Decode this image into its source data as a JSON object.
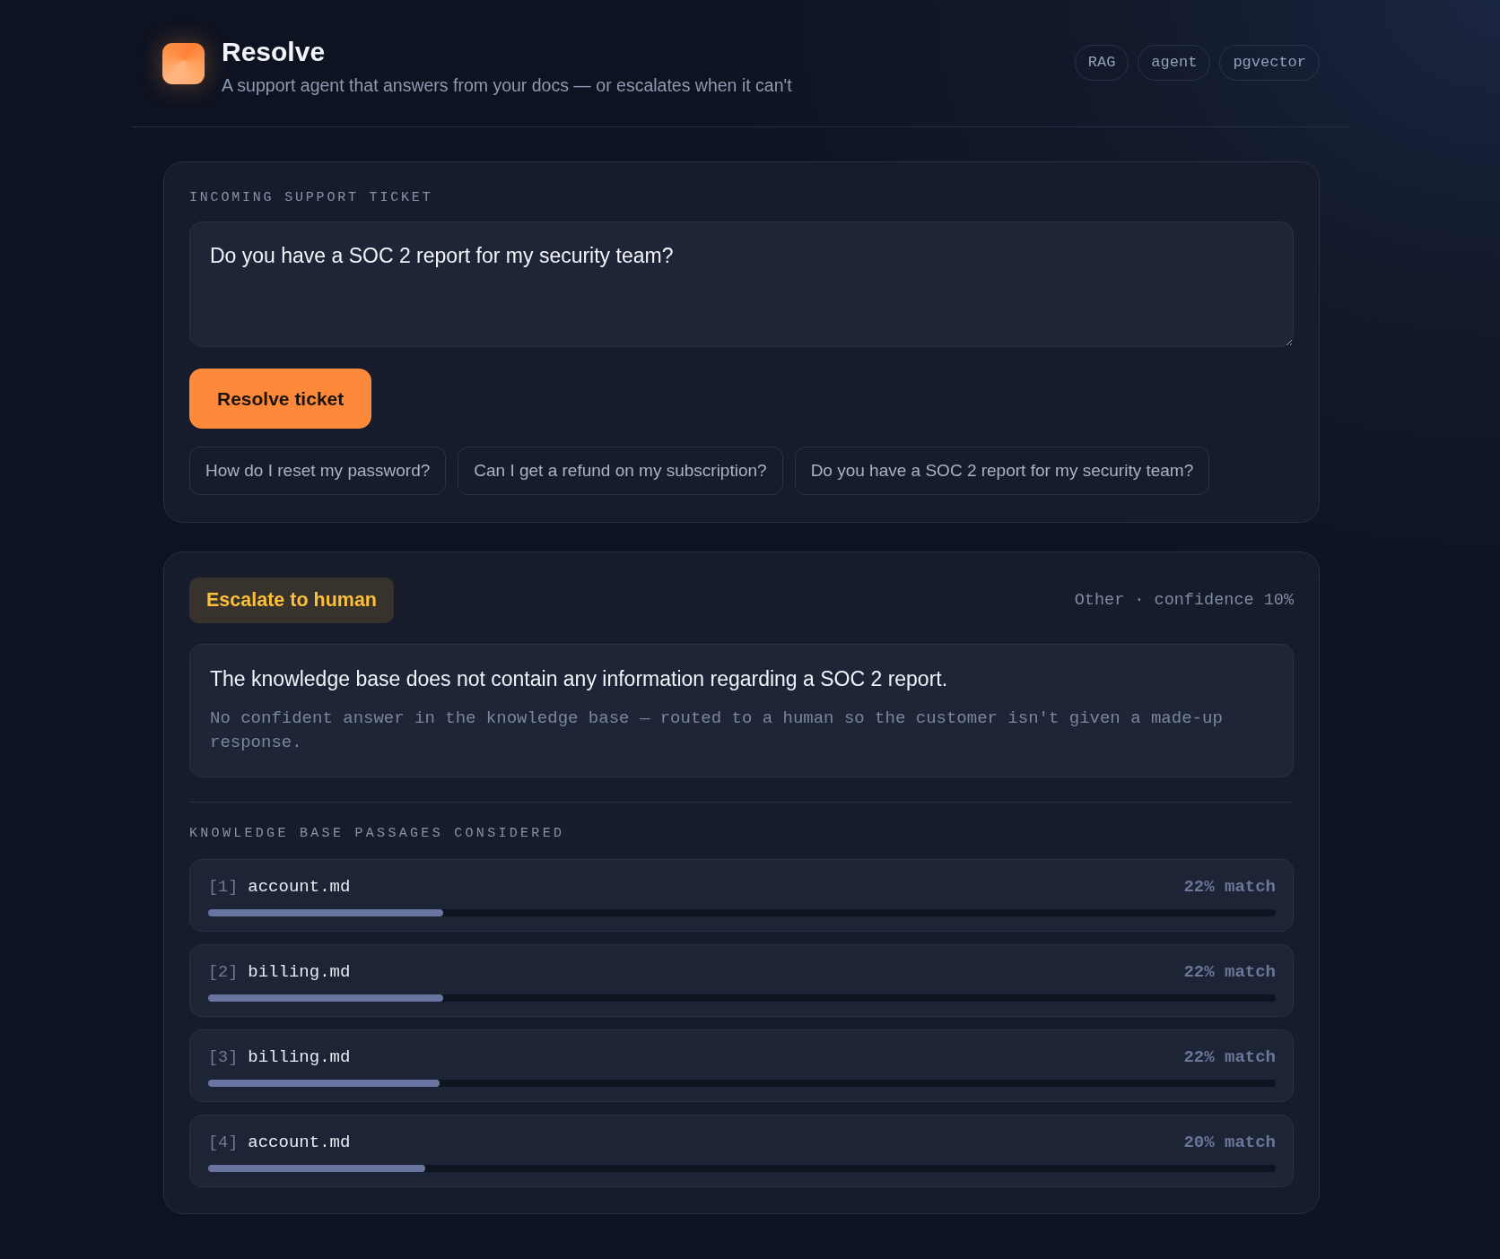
{
  "header": {
    "title": "Resolve",
    "subtitle": "A support agent that answers from your docs — or escalates when it can't",
    "tags": [
      "RAG",
      "agent",
      "pgvector"
    ]
  },
  "ticket": {
    "label": "INCOMING SUPPORT TICKET",
    "value": "Do you have a SOC 2 report for my security team?",
    "submit": "Resolve ticket",
    "examples": [
      "How do I reset my password?",
      "Can I get a refund on my subscription?",
      "Do you have a SOC 2 report for my security team?"
    ]
  },
  "result": {
    "decision": {
      "kind": "escalate",
      "label": "Escalate to human"
    },
    "meta": "Other · confidence 10%",
    "answer": "The knowledge base does not contain any information regarding a SOC 2 report.",
    "note": "No confident answer in the knowledge base — routed to a human so the customer isn't given a made-up response.",
    "passages_label": "KNOWLEDGE BASE PASSAGES CONSIDERED",
    "passages": [
      {
        "index": "[1]",
        "source": "account.md",
        "match": "22% match",
        "level": 0.22
      },
      {
        "index": "[2]",
        "source": "billing.md",
        "match": "22% match",
        "level": 0.22
      },
      {
        "index": "[3]",
        "source": "billing.md",
        "match": "22% match",
        "level": 0.217
      },
      {
        "index": "[4]",
        "source": "account.md",
        "match": "20% match",
        "level": 0.203
      }
    ]
  }
}
